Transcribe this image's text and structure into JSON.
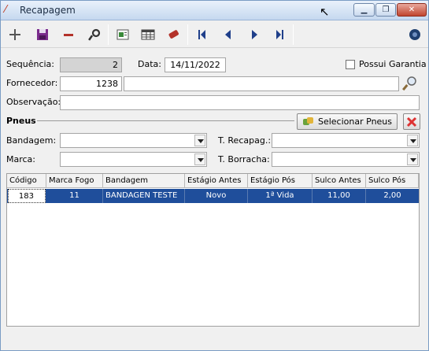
{
  "window": {
    "title": "Recapagem",
    "buttons": {
      "minimize": "▁",
      "maximize": "❐",
      "close": "✕"
    }
  },
  "toolbar": {
    "icons": [
      "plus-icon",
      "save-icon",
      "minus-icon",
      "search-icon",
      "report-icon",
      "grid-icon",
      "eraser-icon",
      "first-icon",
      "prev-icon",
      "next-icon",
      "last-icon",
      "help-icon"
    ]
  },
  "form": {
    "sequencia_label": "Sequência:",
    "sequencia_value": "2",
    "data_label": "Data:",
    "data_value": "14/11/2022",
    "garantia_label": "Possui Garantia",
    "fornecedor_label": "Fornecedor:",
    "fornecedor_code": "1238",
    "fornecedor_name": "",
    "observacao_label": "Observação:",
    "observacao_value": ""
  },
  "pneus": {
    "section_label": "Pneus",
    "select_button": "Selecionar Pneus",
    "bandagem_label": "Bandagem:",
    "recapag_label": "T. Recapag.:",
    "marca_label": "Marca:",
    "borracha_label": "T. Borracha:"
  },
  "grid": {
    "columns": [
      "Código",
      "Marca Fogo",
      "Bandagem",
      "Estágio Antes",
      "Estágio Pós",
      "Sulco Antes",
      "Sulco Pós"
    ],
    "rows": [
      [
        "183",
        "11",
        "BANDAGEN TESTE",
        "Novo",
        "1ª Vida",
        "11,00",
        "2,00"
      ]
    ]
  }
}
